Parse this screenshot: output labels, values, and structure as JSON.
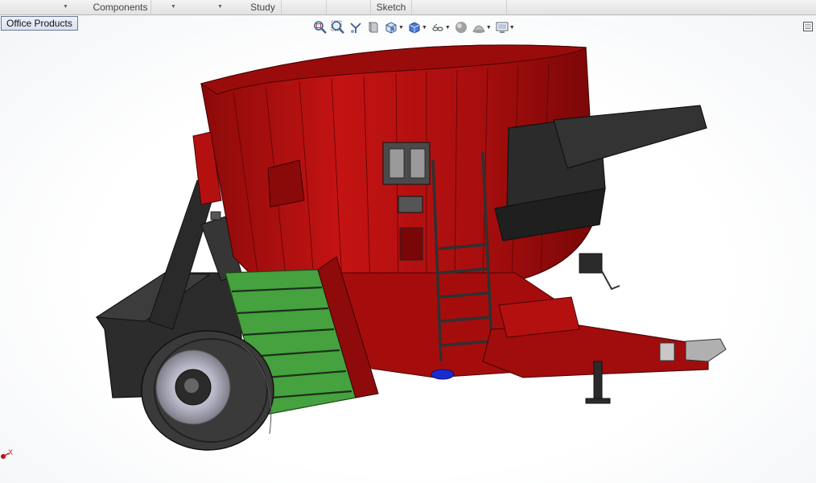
{
  "tabs": {
    "components": "Components",
    "study": "Study",
    "sketch": "Sketch"
  },
  "tree_tag": "Office Products",
  "hud_icons": [
    "zoom-to-fit-icon",
    "zoom-to-area-icon",
    "previous-view-icon",
    "section-view-icon",
    "view-orientation-icon",
    "display-style-icon",
    "hide-show-items-icon",
    "edit-appearance-icon",
    "apply-scene-icon",
    "view-settings-icon"
  ],
  "triad_label": "X",
  "colors": {
    "hull": "#b00e0e",
    "hull_dark": "#7e0808",
    "chassis": "#2b2b2b",
    "conveyor": "#3f9b3a",
    "tire": "#333333",
    "rim": "#a8a8b8",
    "motor": "#1a2bd0"
  }
}
